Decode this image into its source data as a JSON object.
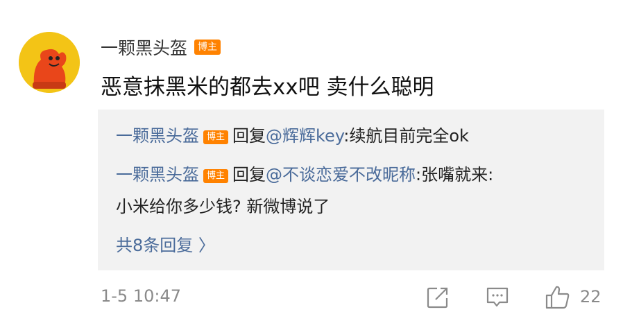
{
  "comment": {
    "username": "一颗黑头盔",
    "badge": "博主",
    "text": "恶意抹黑米的都去xx吧 卖什么聪明",
    "time": "1-5 10:47",
    "like_count": "22"
  },
  "replies": [
    {
      "name": "一颗黑头盔",
      "badge": "博主",
      "reply_word": "回复",
      "mention": "@辉辉key",
      "text": ":续航目前完全ok"
    },
    {
      "name": "一颗黑头盔",
      "badge": "博主",
      "reply_word": "回复",
      "mention": "@不谈恋爱不改昵称",
      "text": ":张嘴就来:",
      "continuation": "小米给你多少钱? 新微博说了"
    }
  ],
  "more_replies_label": "共8条回复 〉",
  "icons": {
    "share": "share-icon",
    "comment": "comment-icon",
    "like": "thumbs-up-icon"
  },
  "colors": {
    "badge": "#ff8200",
    "link": "#4a6b9a",
    "avatar_bg": "#f3c416"
  }
}
